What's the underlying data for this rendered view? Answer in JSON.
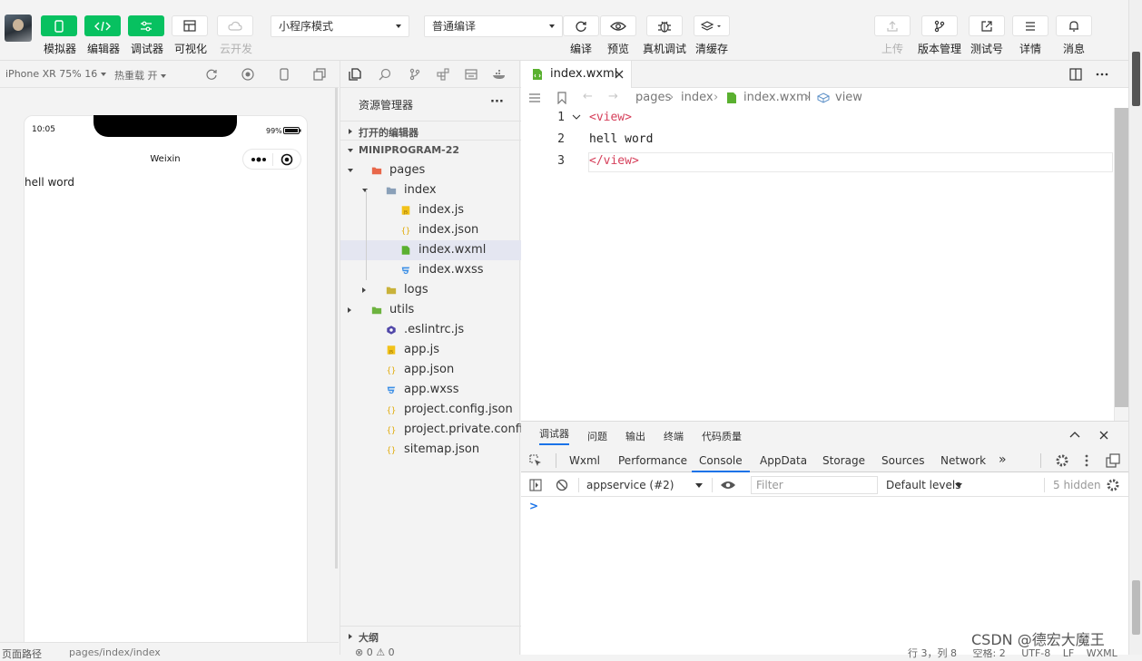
{
  "toolbar": {
    "simulator_label": "模拟器",
    "editor_label": "编辑器",
    "debugger_label": "调试器",
    "visual_label": "可视化",
    "cloud_dev_label": "云开发",
    "mode_select": "小程序模式",
    "compile_select": "普通编译",
    "compile_label": "编译",
    "preview_label": "预览",
    "real_debug_label": "真机调试",
    "clear_cache_label": "清缓存",
    "upload_label": "上传",
    "version_label": "版本管理",
    "test_label": "测试号",
    "details_label": "详情",
    "messages_label": "消息"
  },
  "simulator": {
    "device": "iPhone XR 75% 16",
    "hot_reload": "热重载 开",
    "time": "10:05",
    "battery": "99%",
    "nav_title": "Weixin",
    "page_text": "hell word",
    "path_label": "页面路径",
    "path_value": "pages/index/index"
  },
  "explorer": {
    "title": "资源管理器",
    "more": "···",
    "open_editors": "打开的编辑器",
    "project": "MINIPROGRAM-22",
    "outline": "大纲",
    "status": "⊗ 0 ⚠ 0",
    "tree": [
      {
        "label": "pages",
        "icon": "folder-pages-icon",
        "color": "#e8674a"
      },
      {
        "label": "index",
        "icon": "folder-open-icon",
        "color": "#8aa0b8"
      },
      {
        "label": "index.js",
        "icon": "js-file-icon",
        "color": "#f2c21a"
      },
      {
        "label": "index.json",
        "icon": "json-file-icon",
        "color": "#e0a800"
      },
      {
        "label": "index.wxml",
        "icon": "wxml-file-icon",
        "color": "#5ab030"
      },
      {
        "label": "index.wxss",
        "icon": "wxss-file-icon",
        "color": "#3a8ee6"
      },
      {
        "label": "logs",
        "icon": "folder-logs-icon",
        "color": "#c9b23a"
      },
      {
        "label": "utils",
        "icon": "folder-utils-icon",
        "color": "#6db33f"
      },
      {
        "label": ".eslintrc.js",
        "icon": "eslint-file-icon",
        "color": "#5047a8"
      },
      {
        "label": "app.js",
        "icon": "js-file-icon",
        "color": "#f2c21a"
      },
      {
        "label": "app.json",
        "icon": "json-file-icon",
        "color": "#e0a800"
      },
      {
        "label": "app.wxss",
        "icon": "wxss-file-icon",
        "color": "#3a8ee6"
      },
      {
        "label": "project.config.json",
        "icon": "json-file-icon",
        "color": "#e0a800"
      },
      {
        "label": "project.private.config.js...",
        "icon": "json-file-icon",
        "color": "#e0a800"
      },
      {
        "label": "sitemap.json",
        "icon": "json-file-icon",
        "color": "#e0a800"
      }
    ]
  },
  "editor": {
    "tab_name": "index.wxml",
    "breadcrumb": [
      "pages",
      "index",
      "index.wxml",
      "view"
    ],
    "lines": [
      {
        "n": "1",
        "text": "<view>"
      },
      {
        "n": "2",
        "text": "hell word"
      },
      {
        "n": "3",
        "text": "</view>"
      }
    ]
  },
  "debug": {
    "top_tabs": [
      "调试器",
      "问题",
      "输出",
      "终端",
      "代码质量"
    ],
    "devtools_tabs": [
      "Wxml",
      "Performance",
      "Console",
      "AppData",
      "Storage",
      "Sources",
      "Network"
    ],
    "context": "appservice (#2)",
    "filter_placeholder": "Filter",
    "levels": "Default levels",
    "hidden": "5 hidden",
    "prompt": ">"
  },
  "statusbar": {
    "row": "行 3，列 8",
    "spaces": "空格: 2",
    "encoding": "UTF-8",
    "eol": "LF",
    "lang": "WXML"
  },
  "watermark": "CSDN @德宏大魔王",
  "colors": {
    "accent_green": "#07c160",
    "tag_red": "#e4507a",
    "active_tab_blue": "#1a73e8"
  }
}
